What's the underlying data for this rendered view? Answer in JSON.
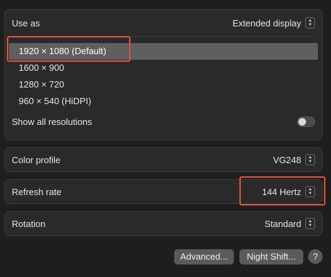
{
  "display": {
    "use_as_label": "Use as",
    "use_as_value": "Extended display",
    "resolutions": [
      {
        "label": "1920 × 1080 (Default)",
        "selected": true
      },
      {
        "label": "1600 × 900",
        "selected": false
      },
      {
        "label": "1280 × 720",
        "selected": false
      },
      {
        "label": "960 × 540 (HiDPI)",
        "selected": false
      }
    ],
    "show_all_label": "Show all resolutions",
    "show_all_enabled": false
  },
  "color_profile": {
    "label": "Color profile",
    "value": "VG248"
  },
  "refresh_rate": {
    "label": "Refresh rate",
    "value": "144 Hertz"
  },
  "rotation": {
    "label": "Rotation",
    "value": "Standard"
  },
  "buttons": {
    "advanced": "Advanced...",
    "night_shift": "Night Shift...",
    "help": "?"
  },
  "icons": {
    "stepper": "chevron-updown-icon"
  },
  "colors": {
    "highlight": "#e5533a",
    "selected_row": "#5f5f5f"
  }
}
